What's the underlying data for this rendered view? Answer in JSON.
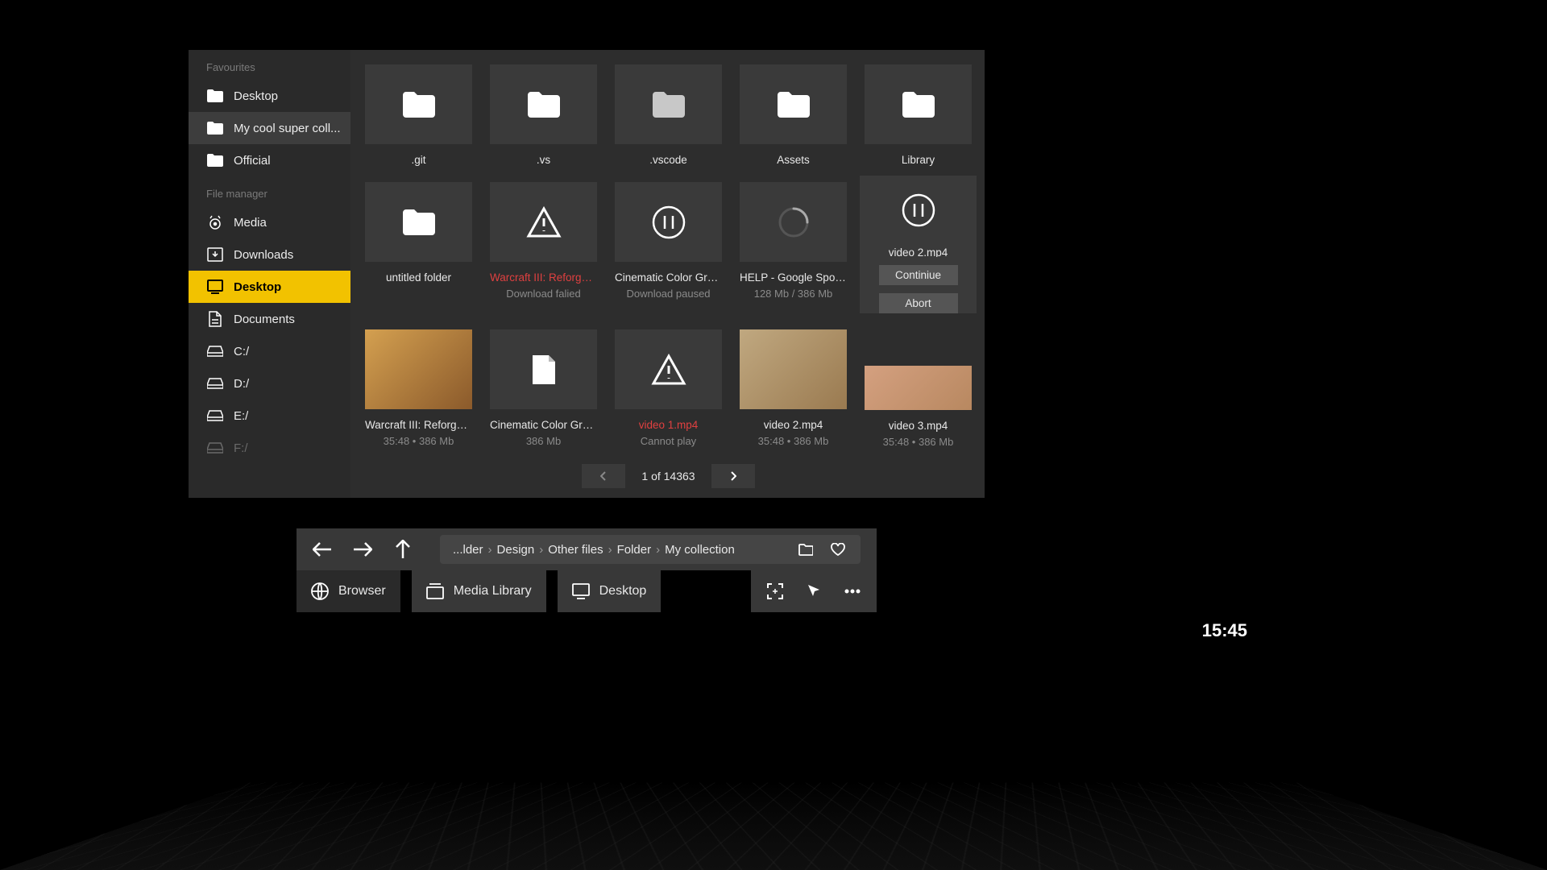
{
  "sidebar": {
    "favourites_header": "Favourites",
    "favourites": [
      {
        "label": "Desktop"
      },
      {
        "label": "My cool super coll..."
      },
      {
        "label": "Official"
      }
    ],
    "filemanager_header": "File manager",
    "items": [
      {
        "label": "Media"
      },
      {
        "label": "Downloads"
      },
      {
        "label": "Desktop"
      },
      {
        "label": "Documents"
      },
      {
        "label": "C:/"
      },
      {
        "label": "D:/"
      },
      {
        "label": "E:/"
      },
      {
        "label": "F:/"
      }
    ]
  },
  "grid": {
    "row1": [
      {
        "name": ".git"
      },
      {
        "name": ".vs"
      },
      {
        "name": ".vscode"
      },
      {
        "name": "Assets"
      },
      {
        "name": "Library"
      }
    ],
    "row2": [
      {
        "name": "untitled folder"
      },
      {
        "name": "Warcraft III: Reforged...",
        "sub": "Download falied"
      },
      {
        "name": "Cinematic Color Grad...",
        "sub": "Download paused"
      },
      {
        "name": "HELP - Google Spoli...",
        "sub": "128 Mb / 386 Mb"
      },
      {
        "name": "video 2.mp4",
        "btn1": "Continiue",
        "btn2": "Abort"
      }
    ],
    "row3": [
      {
        "name": "Warcraft III: Reforged...",
        "sub": "35:48   •   386 Mb"
      },
      {
        "name": "Cinematic Color Grad...",
        "sub": "386 Mb"
      },
      {
        "name": "video 1.mp4",
        "sub": "Cannot play"
      },
      {
        "name": "video 2.mp4",
        "sub": "35:48   •   386 Mb"
      },
      {
        "name": "video 3.mp4",
        "sub": "35:48   •   386 Mb"
      }
    ]
  },
  "pager": {
    "text": "1 of 14363"
  },
  "breadcrumb": {
    "parts": [
      "...lder",
      "Design",
      "Other files",
      "Folder",
      "My collection"
    ]
  },
  "tabs": {
    "browser": "Browser",
    "media": "Media Library",
    "desktop": "Desktop"
  },
  "clock": "15:45"
}
